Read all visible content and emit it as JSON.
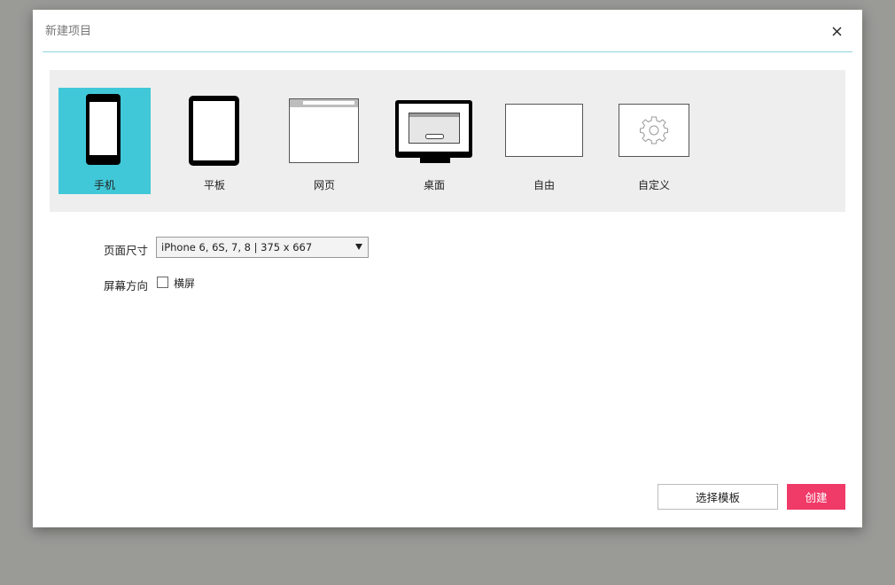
{
  "dialog": {
    "title": "新建项目",
    "close_icon": "close-icon"
  },
  "device_types": [
    {
      "label": "手机",
      "icon": "phone-icon",
      "selected": true
    },
    {
      "label": "平板",
      "icon": "tablet-icon",
      "selected": false
    },
    {
      "label": "网页",
      "icon": "webpage-icon",
      "selected": false
    },
    {
      "label": "桌面",
      "icon": "desktop-icon",
      "selected": false
    },
    {
      "label": "自由",
      "icon": "free-canvas-icon",
      "selected": false
    },
    {
      "label": "自定义",
      "icon": "gear-icon",
      "selected": false
    }
  ],
  "page_size": {
    "label": "页面尺寸",
    "value": "iPhone 6, 6S, 7, 8 | 375 x 667"
  },
  "orientation": {
    "label": "屏幕方向",
    "option_label": "横屏",
    "checked": false
  },
  "buttons": {
    "template": "选择模板",
    "create": "创建"
  },
  "colors": {
    "accent": "#40c8d8",
    "create_button": "#f03a68",
    "divider": "#8fd3dd",
    "panel_bg": "#eeeeee"
  }
}
